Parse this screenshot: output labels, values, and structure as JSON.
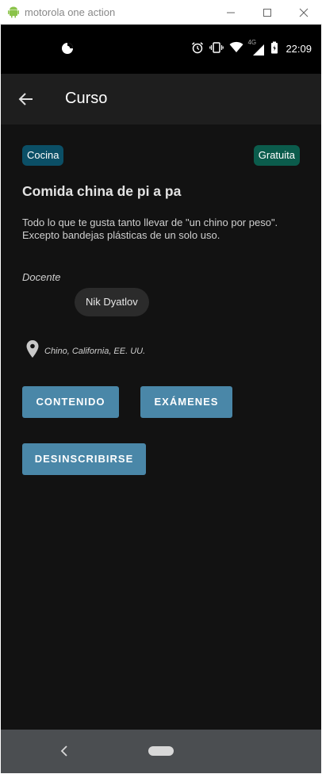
{
  "window": {
    "title": "motorola one action"
  },
  "statusbar": {
    "network": "4G",
    "time": "22:09"
  },
  "appbar": {
    "title": "Curso"
  },
  "course": {
    "category": "Cocina",
    "price": "Gratuita",
    "title": "Comida china de pi a pa",
    "description": "Todo lo que te gusta tanto llevar de \"un chino por peso\". Excepto bandejas plásticas de un solo uso.",
    "teacher_label": "Docente",
    "teacher_name": "Nik Dyatlov",
    "location": "Chino, California, EE. UU."
  },
  "actions": {
    "contenido": "CONTENIDO",
    "examenes": "EXÁMENES",
    "desinscribirse": "DESINSCRIBIRSE"
  },
  "colors": {
    "background": "#121212",
    "appbar": "#1e1e1e",
    "category_chip": "#0b4f66",
    "price_chip": "#0b5c4c",
    "button": "#4a87a8",
    "navbar": "#4b4e51"
  },
  "icons": {
    "window": [
      "android-icon",
      "minimize-icon",
      "maximize-icon",
      "close-icon"
    ],
    "status": [
      "data-saver-icon",
      "alarm-icon",
      "vibrate-icon",
      "wifi-icon",
      "signal-icon",
      "battery-icon"
    ],
    "app": [
      "back-arrow-icon",
      "location-pin-icon"
    ],
    "nav": [
      "nav-back-icon",
      "nav-home-pill"
    ]
  }
}
